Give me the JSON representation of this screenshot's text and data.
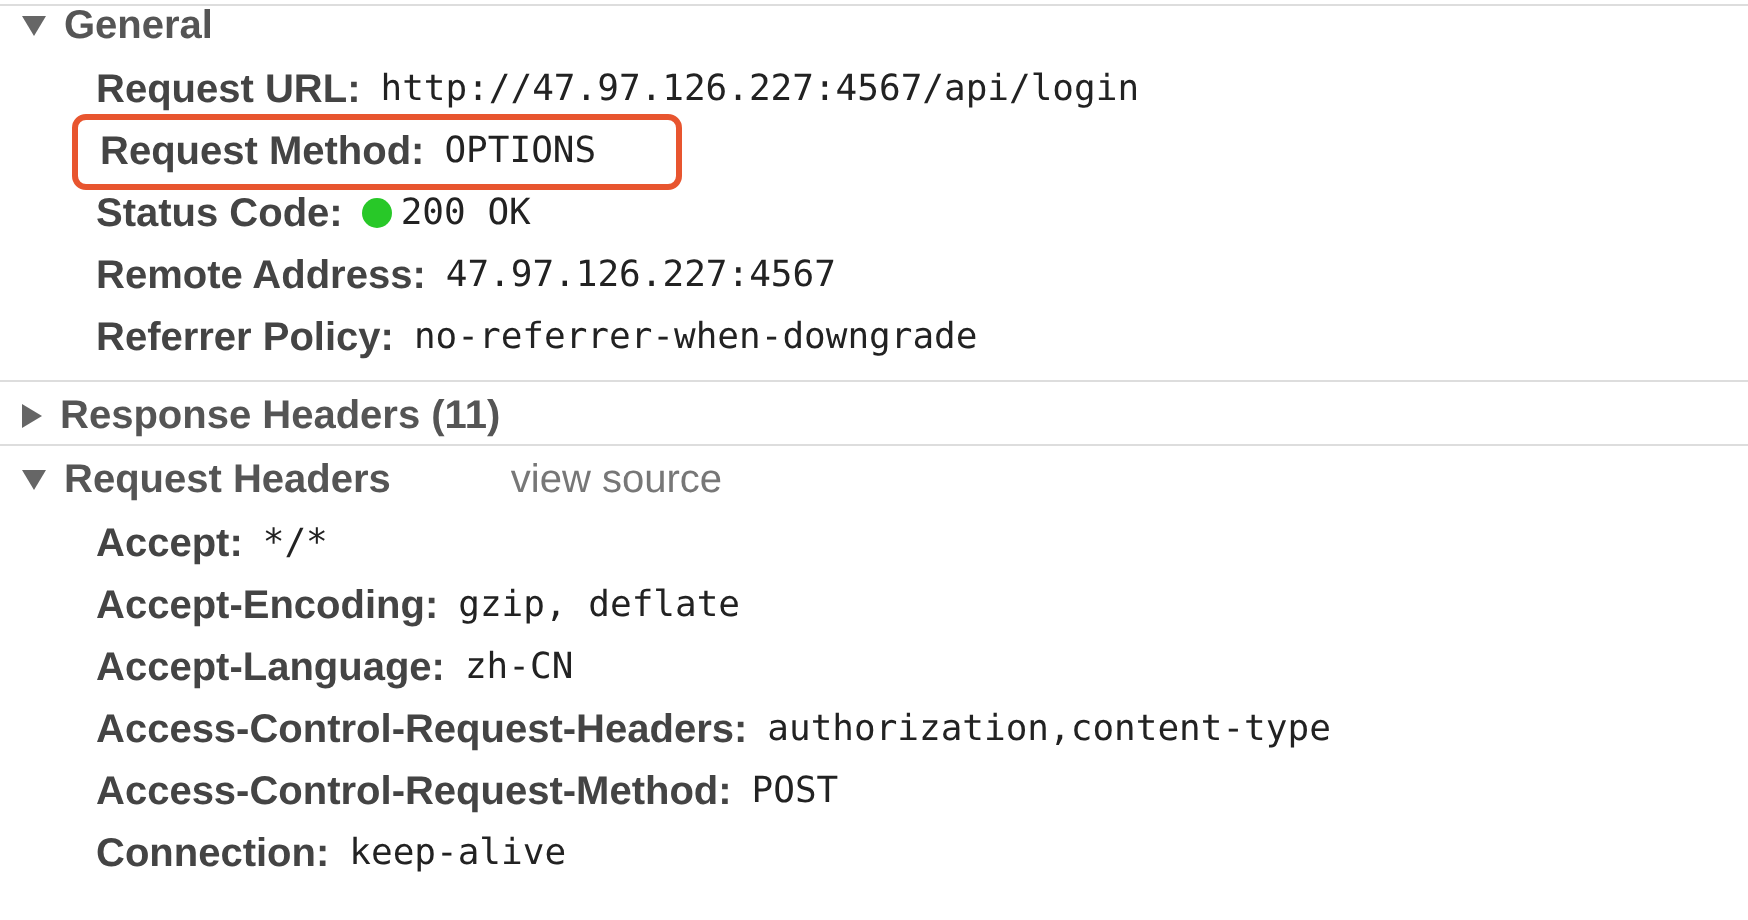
{
  "sections": [
    {
      "title": "General",
      "expanded": true,
      "rows": [
        {
          "label": "Request URL:",
          "value": "http://47.97.126.227:4567/api/login",
          "highlighted": false
        },
        {
          "label": "Request Method:",
          "value": "OPTIONS",
          "highlighted": true
        },
        {
          "label": "Status Code:",
          "value": "200 OK",
          "highlighted": false,
          "color": "#28c828"
        },
        {
          "label": "Remote Address:",
          "value": "47.97.126.227:4567",
          "highlighted": false
        },
        {
          "label": "Referrer Policy:",
          "value": "no-referrer-when-downgrade",
          "highlighted": false
        }
      ]
    },
    {
      "title": "Response Headers (11)",
      "expanded": false
    },
    {
      "title": "Request Headers",
      "expanded": true,
      "link": "view source",
      "rows": [
        {
          "label": "Accept:",
          "value": "*/*",
          "highlighted": false
        },
        {
          "label": "Accept-Encoding:",
          "value": "gzip, deflate",
          "highlighted": false
        },
        {
          "label": "Accept-Language:",
          "value": "zh-CN",
          "highlighted": false
        },
        {
          "label": "Access-Control-Request-Headers:",
          "value": "authorization,content-type",
          "highlighted": false
        },
        {
          "label": "Access-Control-Request-Method:",
          "value": "POST",
          "highlighted": false
        },
        {
          "label": "Connection:",
          "value": "keep-alive",
          "highlighted": false
        }
      ]
    }
  ]
}
